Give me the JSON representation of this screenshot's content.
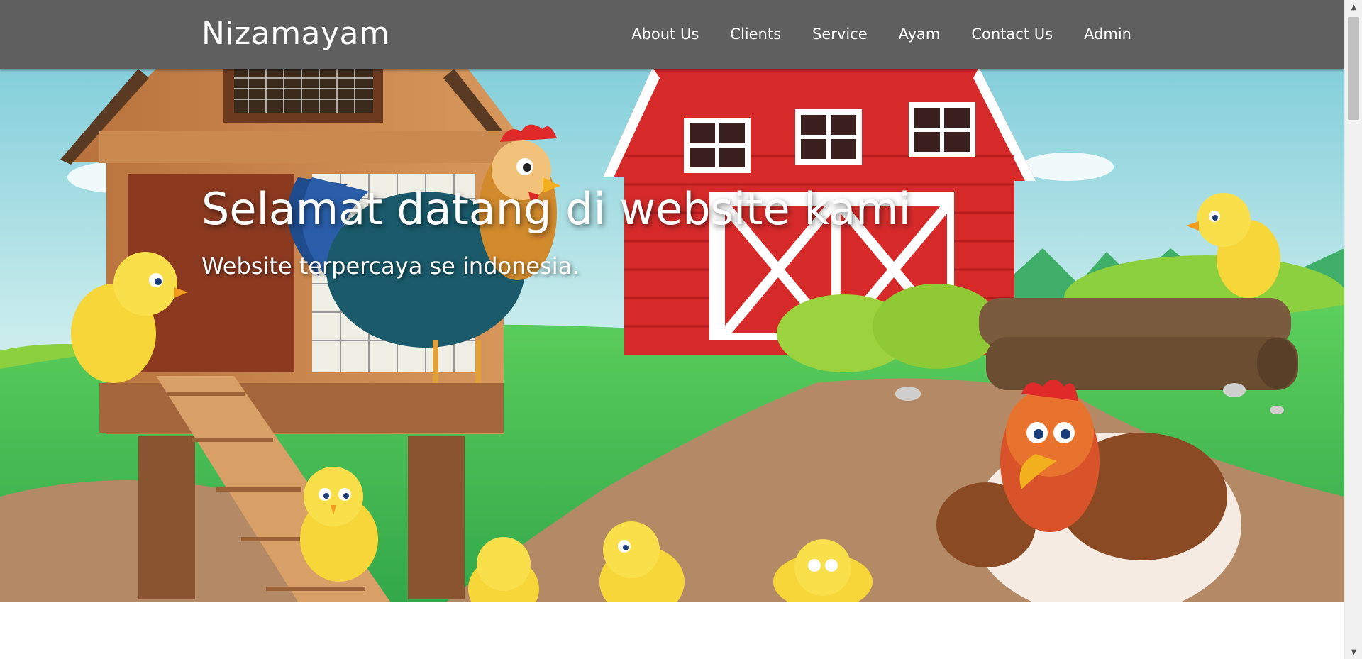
{
  "navbar": {
    "brand": "Nizamayam",
    "links": [
      "About Us",
      "Clients",
      "Service",
      "Ayam",
      "Contact Us",
      "Admin"
    ]
  },
  "hero": {
    "title": "Selamat datang di website kami",
    "subtitle": "Website terpercaya se indonesia."
  },
  "colors": {
    "navbar": "#5f5f5f",
    "sky": "#9fd8df",
    "grass": "#4fbf4a",
    "barn": "#d62a2a",
    "path": "#b08a66"
  },
  "scrollbar": {
    "up_icon": "triangle-up-icon",
    "down_icon": "triangle-down-icon"
  }
}
